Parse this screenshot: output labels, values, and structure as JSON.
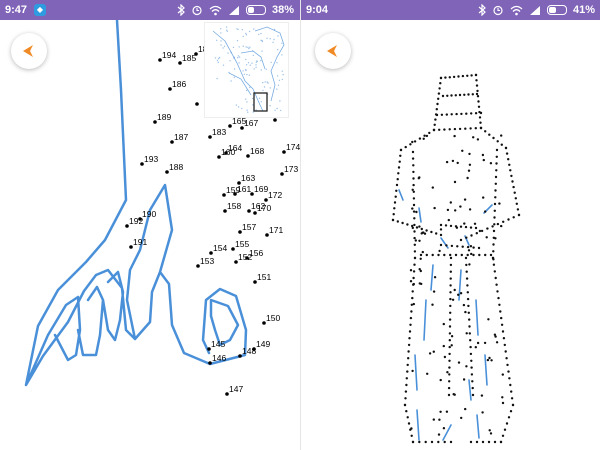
{
  "left_screen": {
    "status_bar": {
      "time": "9:47",
      "battery_percent": "38%",
      "app_badge_icon": "shield-icon"
    },
    "back_button": {
      "icon": "arrow-left-icon"
    },
    "accent_color": "#4a90d9",
    "dot_labels": [
      "194",
      "185",
      "181",
      "186",
      "189",
      "187",
      "183",
      "165",
      "167",
      "193",
      "188",
      "164",
      "160",
      "168",
      "174",
      "163",
      "173",
      "159",
      "161",
      "169",
      "172",
      "158",
      "162",
      "170",
      "190",
      "192",
      "191",
      "157",
      "171",
      "154",
      "155",
      "153",
      "152",
      "156",
      "151",
      "150",
      "145",
      "146",
      "148",
      "149",
      "147"
    ]
  },
  "right_screen": {
    "status_bar": {
      "time": "9:04",
      "battery_percent": "41%"
    },
    "back_button": {
      "icon": "arrow-left-icon"
    }
  },
  "status_colors": {
    "bar": "#8064b8",
    "accent": "#f08a24",
    "line": "#4a90d9"
  }
}
